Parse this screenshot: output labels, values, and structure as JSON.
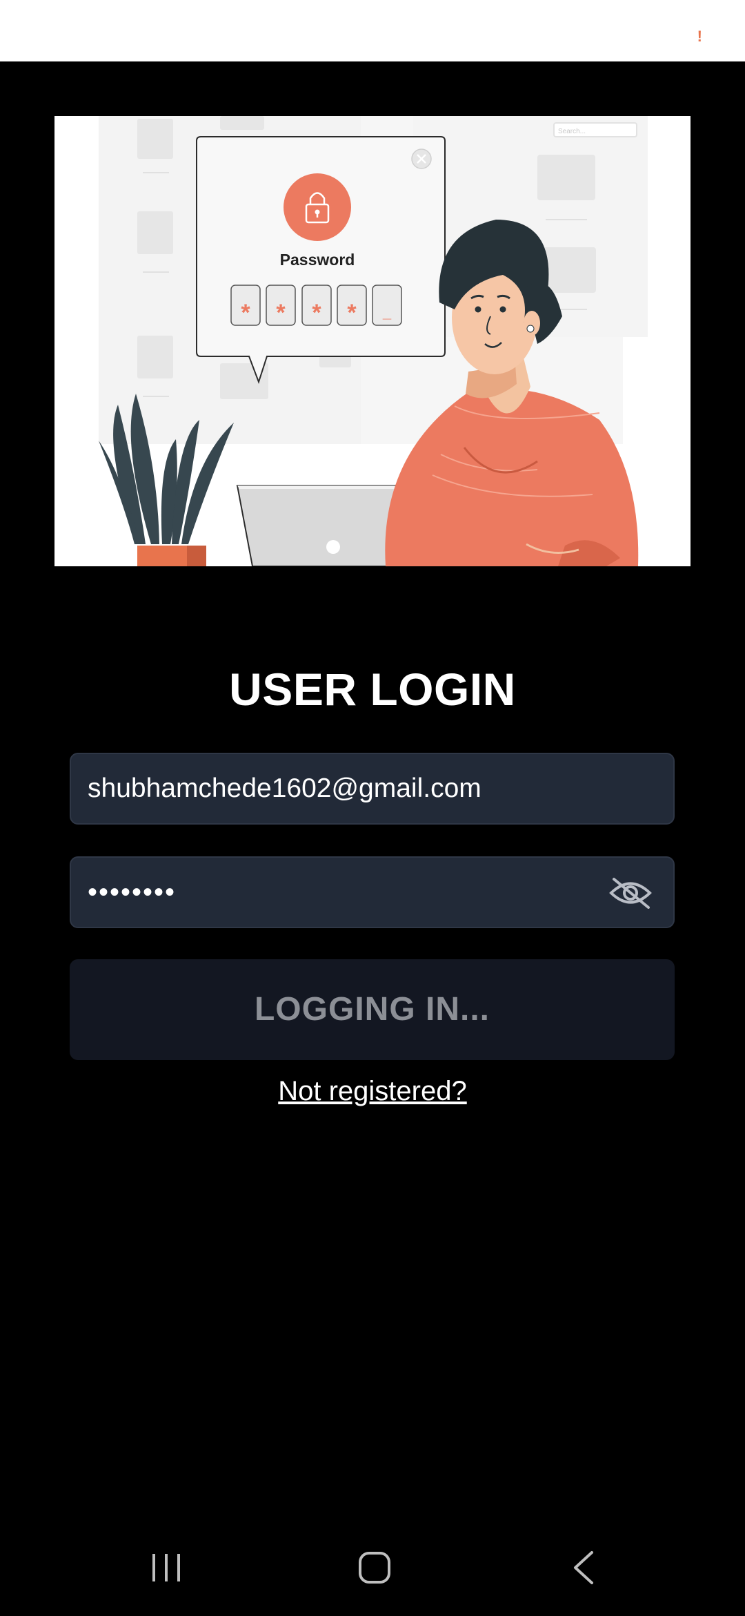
{
  "status_bar": {
    "warning_mark": "!"
  },
  "hero_image": {
    "icon": "password-illustration",
    "dialog_title": "Password",
    "search_placeholder": "Search...",
    "pin_slots": [
      "*",
      "*",
      "*",
      "*",
      "_"
    ]
  },
  "login": {
    "title": "USER LOGIN",
    "email_value": "shubhamchede1602@gmail.com",
    "password_value": "••••••••",
    "password_toggle_icon": "eye-off-icon",
    "submit_label": "LOGGING IN...",
    "register_link": "Not registered?"
  },
  "system_nav": {
    "recent_icon": "recent-apps-icon",
    "home_icon": "home-icon",
    "back_icon": "back-icon"
  },
  "colors": {
    "accent": "#e8744d",
    "field_bg": "#222a38",
    "button_bg": "#131722",
    "page_bg": "#000000"
  }
}
